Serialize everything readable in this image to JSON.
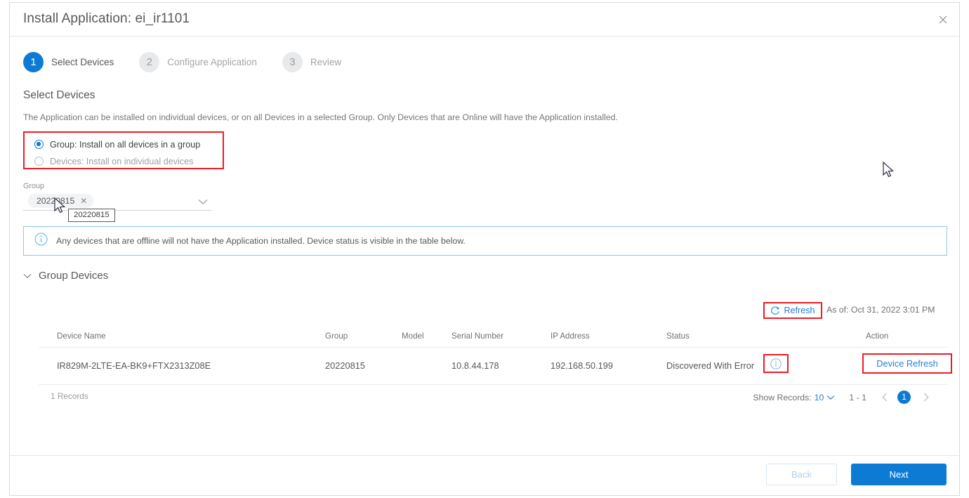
{
  "dialog": {
    "title": "Install Application: ei_ir1101",
    "close_icon": "close-icon"
  },
  "stepper": {
    "steps": [
      {
        "num": "1",
        "label": "Select Devices",
        "state": "active"
      },
      {
        "num": "2",
        "label": "Configure Application",
        "state": "inactive"
      },
      {
        "num": "3",
        "label": "Review",
        "state": "inactive"
      }
    ]
  },
  "section": {
    "title": "Select Devices",
    "description": "The Application can be installed on individual devices, or on all Devices in a selected Group. Only Devices that are Online will have the Application installed."
  },
  "install_target": {
    "options": [
      {
        "label": "Group: Install on all devices in a group",
        "selected": true
      },
      {
        "label": "Devices: Install on individual devices",
        "selected": false
      }
    ]
  },
  "group_select": {
    "label": "Group",
    "chip_value": "20220815",
    "chip_remove_icon": "close-icon",
    "caret_icon": "chevron-down-icon",
    "tooltip": "20220815"
  },
  "info_banner": {
    "icon": "info-circle-icon",
    "text": "Any devices that are offline will not have the Application installed. Device status is visible in the table below."
  },
  "group_devices": {
    "caret_icon": "chevron-down-icon",
    "title": "Group Devices"
  },
  "toolbar": {
    "refresh_icon": "refresh-icon",
    "refresh_label": "Refresh",
    "as_of": "As of: Oct 31, 2022 3:01 PM"
  },
  "table": {
    "columns": [
      "Device Name",
      "Group",
      "Model",
      "Serial Number",
      "IP Address",
      "Status",
      "Action"
    ],
    "rows": [
      {
        "device_name": "IR829M-2LTE-EA-BK9+FTX2313Z08E",
        "group": "20220815",
        "model": "",
        "serial_number": "10.8.44.178",
        "ip_address": "192.168.50.199",
        "status": "Discovered With Error",
        "status_info_icon": "info-circle-icon",
        "action": "Device Refresh"
      }
    ],
    "footer": {
      "records": "1 Records",
      "show_records_label": "Show Records:",
      "show_records_value": "10",
      "show_records_caret": "chevron-down-icon",
      "range": "1 - 1",
      "prev_icon": "chevron-left-icon",
      "page": "1",
      "next_icon": "chevron-right-icon"
    }
  },
  "footer": {
    "back_label": "Back",
    "next_label": "Next"
  }
}
